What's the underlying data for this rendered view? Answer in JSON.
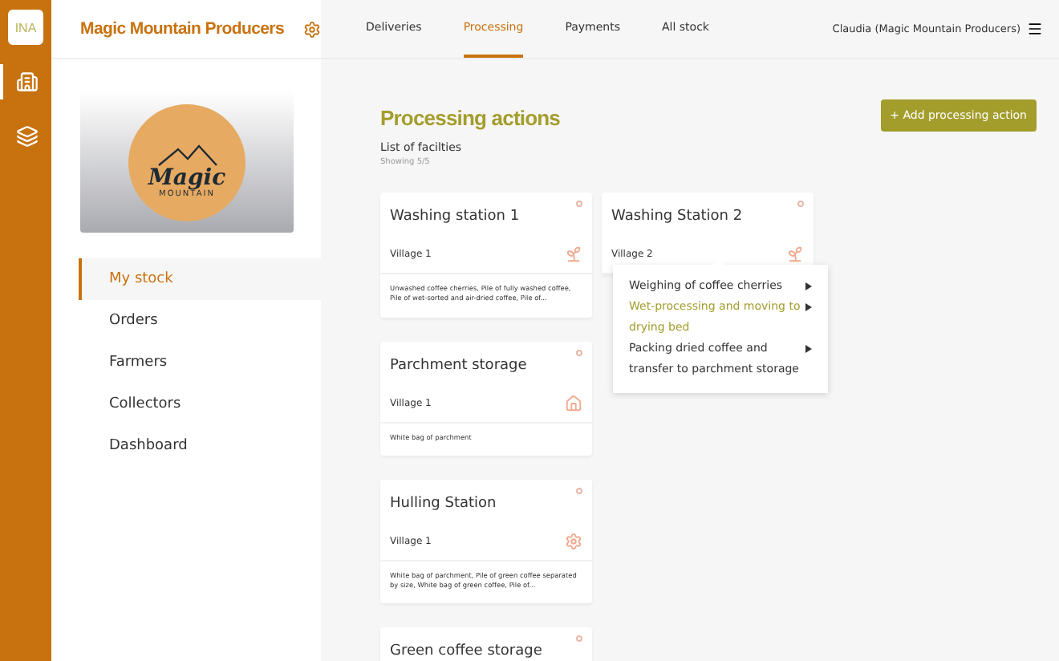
{
  "rail": {
    "logo": "INA",
    "items": [
      {
        "kind": "building",
        "selected": true
      },
      {
        "kind": "layers",
        "selected": false
      }
    ]
  },
  "sidebar": {
    "company": "Magic Mountain Producers",
    "logo_text": {
      "word": "Magic",
      "subword": "MOUNTAIN"
    },
    "items": [
      {
        "label": "My stock",
        "selected": true
      },
      {
        "label": "Orders",
        "selected": false
      },
      {
        "label": "Farmers",
        "selected": false
      },
      {
        "label": "Collectors",
        "selected": false
      },
      {
        "label": "Dashboard",
        "selected": false
      }
    ]
  },
  "tabs": [
    {
      "label": "Deliveries",
      "selected": false
    },
    {
      "label": "Processing",
      "selected": true
    },
    {
      "label": "Payments",
      "selected": false
    },
    {
      "label": "All stock",
      "selected": false
    }
  ],
  "user": "Claudia (Magic Mountain Producers)",
  "page": {
    "title": "Processing actions",
    "add_button": "+ Add processing action",
    "subtitle": "List of facilties",
    "count": "Showing 5/5"
  },
  "facilities": [
    {
      "name": "Washing station 1",
      "location": "Village 1",
      "kind": "sprout",
      "description": "Unwashed coffee cherries, Pile of fully washed coffee, Pile of wet-sorted and air-dried coffee, Pile of..."
    },
    {
      "name": "Washing Station 2",
      "location": "Village 2",
      "kind": "sprout"
    },
    {
      "name": "Parchment storage",
      "location": "Village 1",
      "kind": "house",
      "description": "White bag of parchment"
    },
    {
      "name": "Hulling Station",
      "location": "Village 1",
      "kind": "gear",
      "description": "White bag of parchment, Pile of green coffee separated by size, White bag of green coffee, Pile of..."
    },
    {
      "name": "Green coffee storage"
    }
  ],
  "menu": {
    "items": [
      {
        "label": "Weighing of coffee cherries",
        "selected": false
      },
      {
        "label": "Wet-processing and moving to drying bed",
        "selected": true
      },
      {
        "label": "Packing dried coffee and transfer to parchment storage",
        "selected": false
      }
    ]
  }
}
